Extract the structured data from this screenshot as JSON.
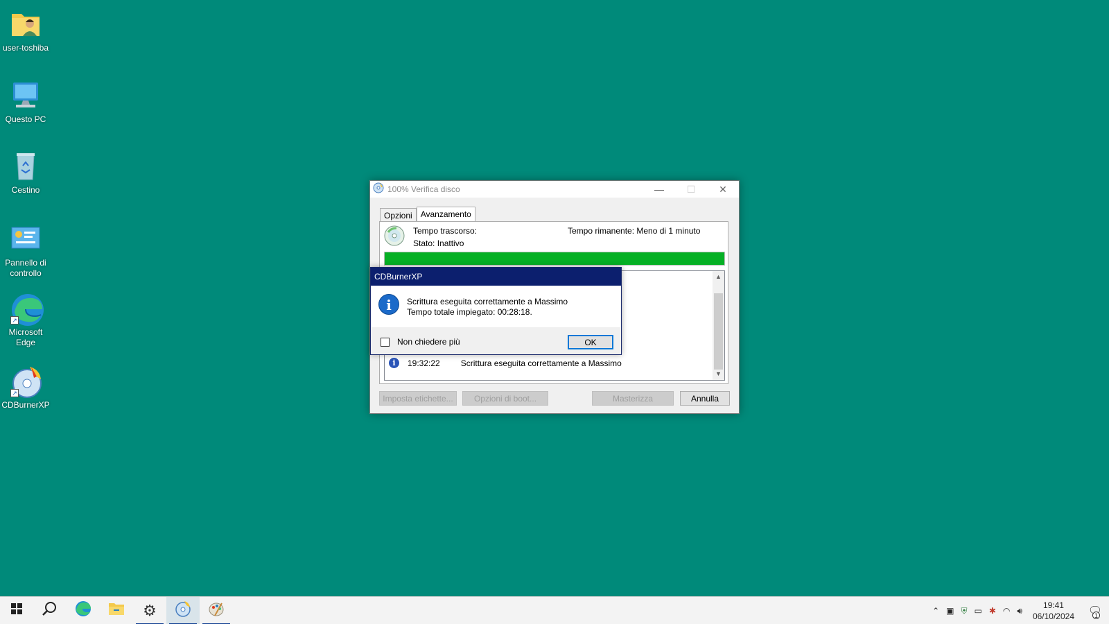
{
  "desktop": {
    "icons": [
      {
        "label": "user-toshiba",
        "icon": "user-folder-icon"
      },
      {
        "label": "Questo PC",
        "icon": "computer-icon"
      },
      {
        "label": "Cestino",
        "icon": "recycle-bin-icon"
      },
      {
        "label": "Pannello di controllo",
        "icon": "control-panel-icon"
      },
      {
        "label": "Microsoft Edge",
        "icon": "edge-icon"
      },
      {
        "label": "CDBurnerXP",
        "icon": "cdburnerxp-icon"
      }
    ]
  },
  "window": {
    "title": "100% Verifica disco",
    "tabs": [
      "Opzioni",
      "Avanzamento"
    ],
    "elapsed_label": "Tempo trascorso:",
    "remaining_label": "Tempo rimanente: Meno di 1 minuto",
    "status_label": "Stato: Inattivo",
    "progress": 1.0,
    "log": [
      {
        "time": "19:32:22",
        "message": "Scrittura eseguita correttamente a Massimo"
      }
    ],
    "buttons": {
      "labels": "Imposta etichette...",
      "boot": "Opzioni di boot...",
      "burn": "Masterizza",
      "cancel": "Annulla"
    }
  },
  "dialog": {
    "title": "CDBurnerXP",
    "line1": "Scrittura eseguita correttamente a Massimo",
    "line2": "Tempo totale impiegato: 00:28:18.",
    "checkbox_label": "Non chiedere più",
    "ok": "OK"
  },
  "taskbar": {
    "time": "19:41",
    "date": "06/10/2024",
    "notification_count": "1"
  },
  "colors": {
    "desktop": "#008a7a",
    "progress": "#06b025",
    "dialog_title": "#0c1f6e"
  }
}
